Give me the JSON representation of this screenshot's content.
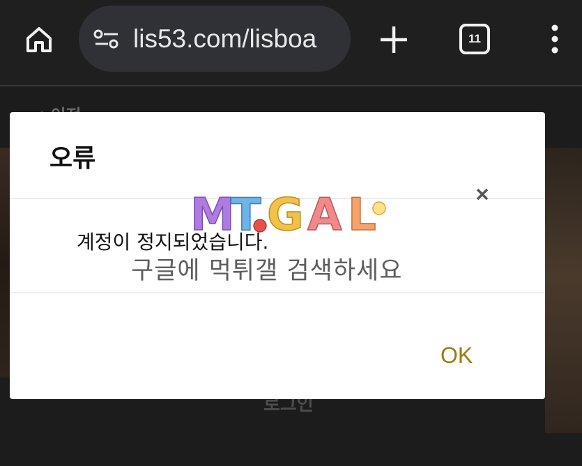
{
  "browser": {
    "url": "lis53.com/lisboa",
    "tab_count": "11",
    "icons": {
      "home": "home-icon",
      "site_settings": "tune-icon",
      "new_tab": "plus-icon",
      "tabs": "tab-switcher-icon",
      "menu": "more-vert-icon"
    }
  },
  "page": {
    "header": "< 이전",
    "bottom_text": "로그인"
  },
  "dialog": {
    "title": "오류",
    "message": "계정이 정지되었습니다.",
    "ok_label": "OK",
    "close_icon": "close-icon"
  },
  "watermark": {
    "logo_text": "MTGAL",
    "caption": "구글에 먹튀갤 검색하세요",
    "colors": {
      "m": "#b07be0",
      "t": "#6fb4e8",
      "g": "#f2c14a",
      "a": "#f08a8a",
      "l": "#f5a36a"
    }
  },
  "colors": {
    "toolbar_bg": "#1f1f1f",
    "url_pill_bg": "#2f3136",
    "dialog_bg": "#ffffff",
    "ok_accent": "#9a7a10"
  }
}
